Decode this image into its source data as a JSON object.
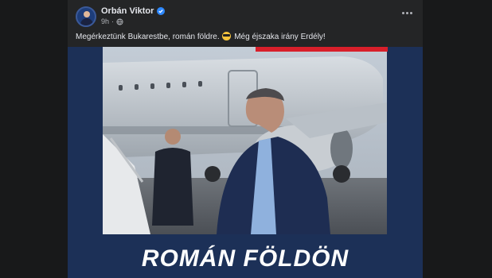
{
  "post": {
    "author": "Orbán Viktor",
    "time": "9h",
    "separator": "·",
    "caption_part1": "Megérkeztünk Bukarestbe, román földre.",
    "caption_part2": "Még éjszaka irány Erdély!",
    "caption_emoji": "smiling-face-with-sunglasses"
  },
  "media": {
    "headline": "ROMÁN FÖLDÖN"
  },
  "colors": {
    "background": "#18191a",
    "card": "#242526",
    "media_bg": "#1c3057",
    "accent_red": "#d81f2a",
    "verified_blue": "#2d88ff"
  },
  "icons": [
    "verified-icon",
    "globe-icon",
    "more-options-icon"
  ]
}
